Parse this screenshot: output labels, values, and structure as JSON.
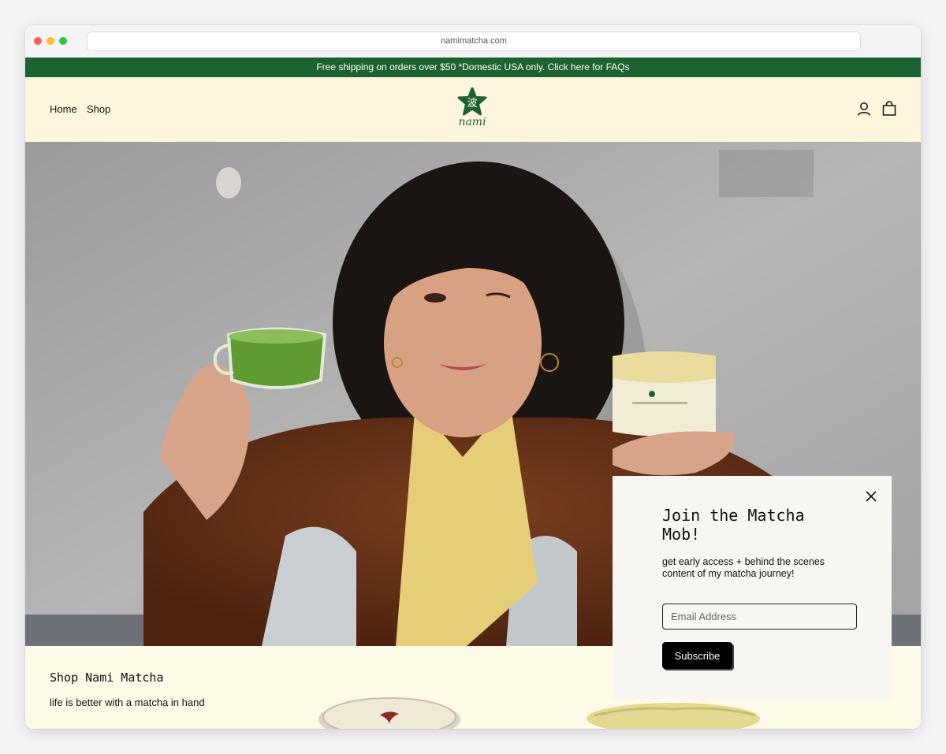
{
  "browser": {
    "url": "namimatcha.com"
  },
  "announcement": {
    "text": "Free shipping on orders over $50 *Domestic USA only. Click here for FAQs"
  },
  "header": {
    "nav": [
      {
        "label": "Home"
      },
      {
        "label": "Shop"
      }
    ],
    "logo": {
      "wordmark": "nami",
      "glyph": "波",
      "color": "#1d6332"
    },
    "icons": {
      "account": "user-icon",
      "cart": "shopping-bag-icon"
    }
  },
  "hero": {
    "image": "woman-holding-matcha-cup-and-tin"
  },
  "shop_section": {
    "title": "Shop Nami Matcha",
    "subtitle": "life is better with a matcha in hand"
  },
  "popup": {
    "title": "Join the Matcha Mob!",
    "text": "get early access + behind the scenes content of my matcha journey!",
    "email_placeholder": "Email Address",
    "subscribe_label": "Subscribe"
  },
  "colors": {
    "brand_green": "#1d6332",
    "header_bg": "#fef6dc",
    "section_bg": "#fefae8",
    "popup_bg": "#f7f6f3"
  }
}
